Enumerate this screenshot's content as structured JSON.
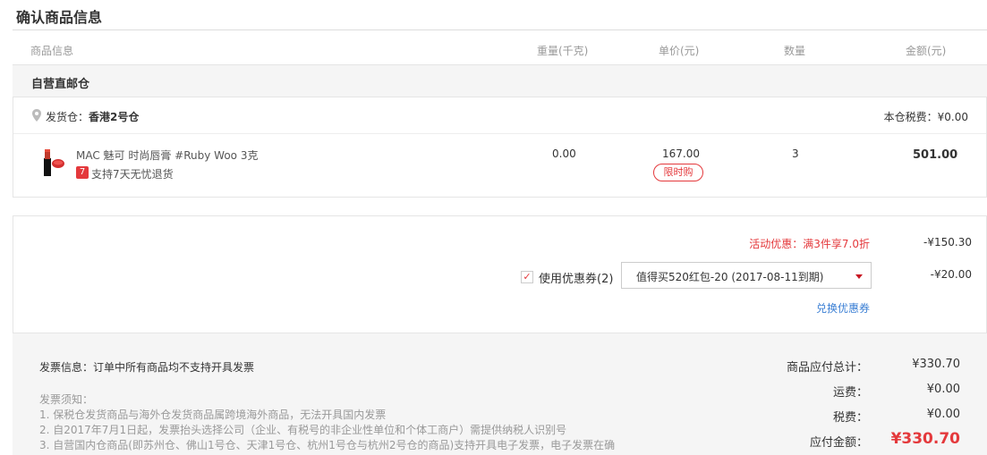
{
  "page_title": "确认商品信息",
  "columns": {
    "product": "商品信息",
    "weight": "重量(千克)",
    "price": "单价(元)",
    "qty": "数量",
    "amount": "金额(元)"
  },
  "warehouse": {
    "name": "自营直邮仓",
    "ship_label": "发货仓：",
    "ship_from": "香港2号仓",
    "tax": "本仓税费：¥0.00"
  },
  "product": {
    "name": "MAC 魅可 时尚唇膏 #Ruby Woo 3克",
    "return_badge": "7",
    "return_text": "支持7天无忧退货",
    "weight": "0.00",
    "price": "167.00",
    "limit_tag": "限时购",
    "qty": "3",
    "amount": "501.00"
  },
  "discounts": {
    "promo_text": "活动优惠：满3件享7.0折",
    "promo_amount": "-¥150.30",
    "coupon_label": "使用优惠券(2)",
    "coupon_selected": "值得买520红包-20 (2017-08-11到期)",
    "coupon_amount": "-¥20.00",
    "exchange_link": "兑换优惠券",
    "checkbox_mark": "✓"
  },
  "invoice": {
    "info": "发票信息：订单中所有商品均不支持开具发票",
    "notice_title": "发票须知：",
    "notice_1": "1. 保税仓发货商品与海外仓发货商品属跨境海外商品，无法开具国内发票",
    "notice_2": "2. 自2017年7月1日起，发票抬头选择公司（企业、有税号的非企业性单位和个体工商户）需提供纳税人识别号",
    "notice_3": "3. 自营国内仓商品(即苏州仓、佛山1号仓、天津1号仓、杭州1号仓与杭州2号仓的商品)支持开具电子发票，电子发票在确"
  },
  "summary": {
    "subtotal_label": "商品应付总计：",
    "subtotal": "¥330.70",
    "shipping_label": "运费：",
    "shipping": "¥0.00",
    "tax_label": "税费：",
    "tax": "¥0.00",
    "payable_label": "应付金额：",
    "payable": "¥330.70"
  },
  "colors": {
    "accent_red": "#e4393c",
    "link_blue": "#3b7fd4"
  }
}
